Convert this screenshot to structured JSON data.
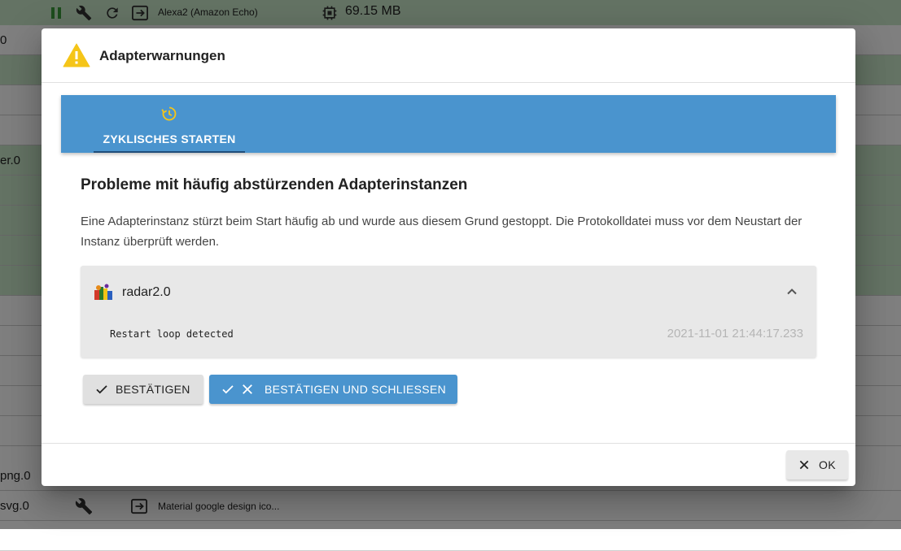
{
  "background": {
    "top_row": {
      "title": "Alexa2 (Amazon Echo)",
      "memory": "69.15 MB"
    },
    "left_fragments": [
      "0",
      "er.0",
      "png.0",
      "svg.0"
    ],
    "bottom_row_title": "Material google design ico..."
  },
  "dialog": {
    "title": "Adapterwarnungen",
    "tab": {
      "label": "ZYKLISCHES STARTEN",
      "icon": "restart-clock-icon"
    },
    "section_title": "Probleme mit häufig abstürzenden Adapterinstanzen",
    "description": "Eine Adapterinstanz stürzt beim Start häufig ab und wurde aus diesem Grund gestoppt. Die Protokolldatei muss vor dem Neustart der Instanz überprüft werden.",
    "instance": {
      "name": "radar2.0",
      "message": "Restart loop detected",
      "timestamp": "2021-11-01 21:44:17.233"
    },
    "buttons": {
      "confirm": "BESTÄTIGEN",
      "confirm_close": "BESTÄTIGEN UND SCHLIESSEN",
      "ok": "OK"
    }
  },
  "colors": {
    "tab_bar": "#4a94ce",
    "warning": "#f5c518",
    "row_green": "#c8e6c9"
  }
}
